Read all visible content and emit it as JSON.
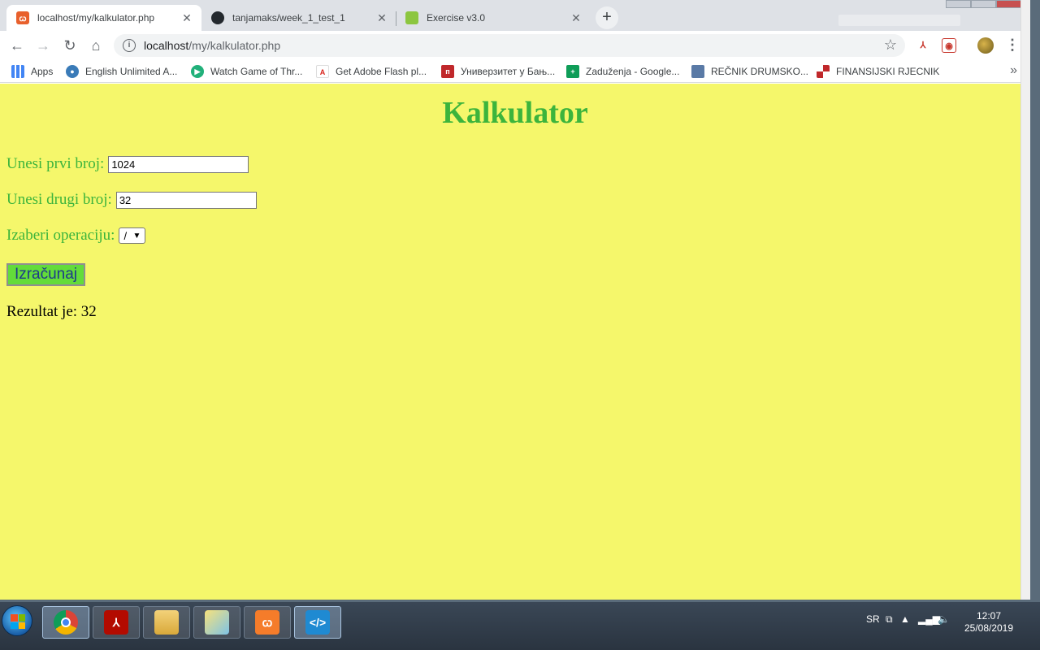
{
  "browser": {
    "tabs": [
      {
        "title": "localhost/my/kalkulator.php",
        "icon": "xampp-icon"
      },
      {
        "title": "tanjamaks/week_1_test_1",
        "icon": "github-icon"
      },
      {
        "title": "Exercise v3.0",
        "icon": "exercise-icon"
      }
    ],
    "url_host": "localhost",
    "url_path": "/my/kalkulator.php",
    "bookmarks": [
      {
        "label": "Apps",
        "icon": "apps-grid-icon"
      },
      {
        "label": "English Unlimited A...",
        "icon": "globe-icon"
      },
      {
        "label": "Watch Game of Thr...",
        "icon": "play-icon"
      },
      {
        "label": "Get Adobe Flash pl...",
        "icon": "adobe-icon"
      },
      {
        "label": "Универзитет у Бањ...",
        "icon": "university-icon"
      },
      {
        "label": "Zaduženja - Google...",
        "icon": "sheets-icon"
      },
      {
        "label": "REČNIK DRUMSKO...",
        "icon": "book-icon"
      },
      {
        "label": "FINANSIJSKI RJECNIK",
        "icon": "checker-icon"
      }
    ],
    "colors": {
      "tabstrip": "#dee1e6",
      "omnibox": "#f1f3f4"
    }
  },
  "page": {
    "title": "Kalkulator",
    "first_label": "Unesi prvi broj:",
    "first_value": "1024",
    "second_label": "Unesi drugi broj:",
    "second_value": "32",
    "operation_label": "Izaberi operaciju:",
    "operation_value": "/",
    "submit_label": "Izračunaj",
    "result_text": "Rezultat je: 32",
    "colors": {
      "background": "#f5f76b",
      "text": "#3cb43c",
      "button": "#63dc3a"
    }
  },
  "taskbar": {
    "apps": [
      "chrome-icon",
      "acrobat-icon",
      "file-explorer-icon",
      "folder-icon",
      "xampp-icon",
      "vscode-icon"
    ],
    "lang": "SR",
    "time": "12:07",
    "date": "25/08/2019"
  }
}
